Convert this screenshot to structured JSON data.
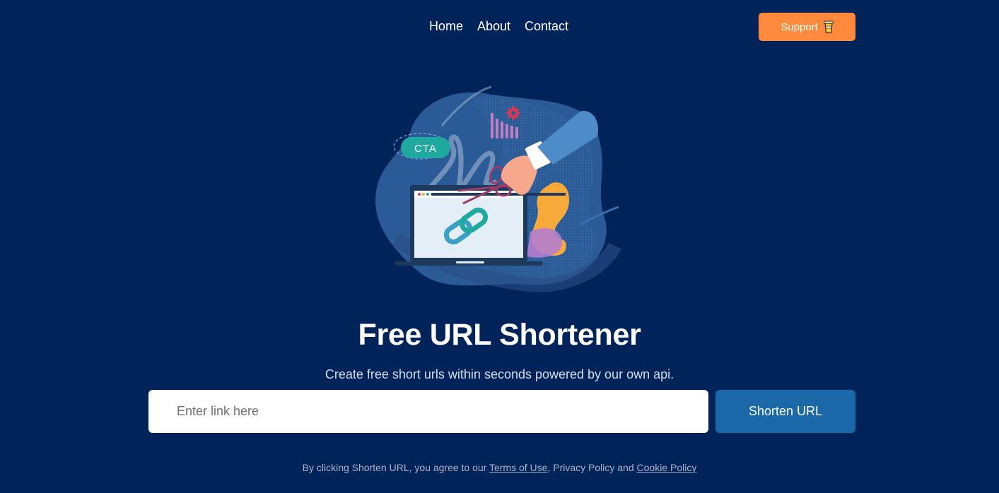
{
  "nav": {
    "home": "Home",
    "about": "About",
    "contact": "Contact"
  },
  "support": {
    "label": "Support",
    "icon": "coffee-cup-icon"
  },
  "hero": {
    "illustration": "url-shortener-illustration",
    "badge_text": "CTA"
  },
  "title": "Free URL Shortener",
  "subtitle": "Create free short urls within seconds powered by our own api.",
  "form": {
    "input_placeholder": "Enter link here",
    "input_value": "",
    "button_label": "Shorten URL"
  },
  "legal": {
    "prefix": "By clicking Shorten URL, you agree to our ",
    "terms": "Terms of Use",
    "middle": ", Privacy Policy and ",
    "cookie": "Cookie Policy"
  },
  "colors": {
    "background": "#00235a",
    "support_button": "#ff8a3d",
    "shorten_button": "#1a68a8"
  }
}
